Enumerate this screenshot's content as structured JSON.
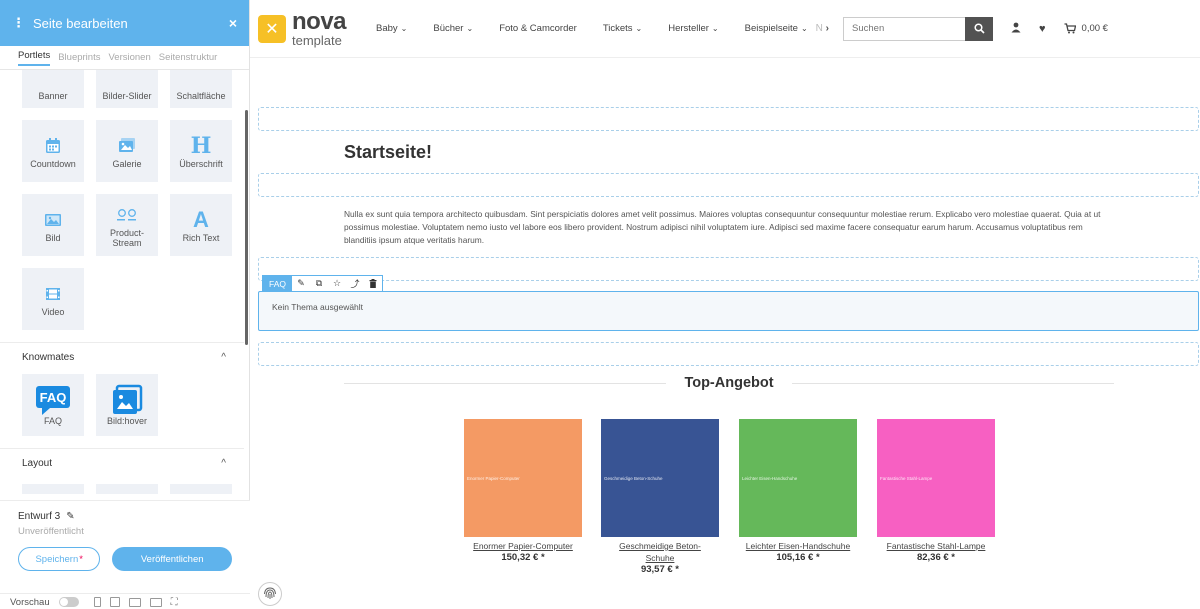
{
  "panel": {
    "title": "Seite bearbeiten",
    "tabs": [
      "Portlets",
      "Blueprints",
      "Versionen",
      "Seitenstruktur"
    ],
    "portlets_partial": [
      "Banner",
      "Bilder-Slider",
      "Schaltfläche"
    ],
    "portlets": [
      {
        "label": "Countdown",
        "icon": "calendar-icon"
      },
      {
        "label": "Galerie",
        "icon": "gallery-icon"
      },
      {
        "label": "Überschrift",
        "icon": "heading-icon",
        "glyph": "H"
      },
      {
        "label": "Bild",
        "icon": "image-icon"
      },
      {
        "label": "Product-\nStream",
        "icon": "product-stream-icon"
      },
      {
        "label": "Rich Text",
        "icon": "rich-text-icon",
        "glyph": "A"
      },
      {
        "label": "Video",
        "icon": "video-icon"
      }
    ],
    "sections": {
      "knowmates": "Knowmates",
      "layout": "Layout"
    },
    "knowmates": [
      {
        "label": "FAQ",
        "icon": "faq-icon",
        "glyph": "FAQ"
      },
      {
        "label": "Bild:hover",
        "icon": "image-hover-icon"
      }
    ],
    "footer": {
      "draft": "Entwurf 3",
      "status": "Unveröffentlicht",
      "save": "Speichern",
      "save_marker": "*",
      "publish": "Veröffentlichen",
      "preview": "Vorschau"
    }
  },
  "header": {
    "logo_big": "nova",
    "logo_small": "template",
    "nav": [
      "Baby",
      "Bücher",
      "Foto & Camcorder",
      "Tickets",
      "Hersteller",
      "Beispielseite"
    ],
    "nav_has_caret": [
      true,
      true,
      false,
      true,
      true,
      true
    ],
    "nav_more": "N",
    "search_placeholder": "Suchen",
    "cart_total": "0,00 €"
  },
  "content": {
    "title": "Startseite!",
    "text": "Nulla ex sunt quia tempora architecto quibusdam. Sint perspiciatis dolores amet velit possimus. Maiores voluptas consequuntur consequuntur molestiae rerum. Explicabo vero molestiae quaerat. Quia at ut possimus molestiae. Voluptatem nemo iusto vel labore eos libero provident. Nostrum adipisci nihil voluptatem iure. Adipisci sed maxime facere consequatur earum harum. Accusamus voluptatibus rem blanditiis ipsum atque veritatis harum.",
    "faq_label": "FAQ",
    "faq_empty": "Kein Thema ausgewählt",
    "top_heading": "Top-Angebot"
  },
  "products": [
    {
      "name": "Enormer Papier-Computer",
      "price": "150,32 € *",
      "img_text": "Enormer Papier-Computer",
      "color": "#f49a64"
    },
    {
      "name": "Geschmeidige Beton-Schuhe",
      "price": "93,57 € *",
      "img_text": "Geschmeidige Beton-Schuhe",
      "color": "#385494"
    },
    {
      "name": "Leichter Eisen-Handschuhe",
      "price": "105,16 € *",
      "img_text": "Leichter Eisen-Handschuhe",
      "color": "#65b85a"
    },
    {
      "name": "Fantastische Stahl-Lampe",
      "price": "82,36 € *",
      "img_text": "Fantastische Stahl-Lampe",
      "color": "#f760c2"
    }
  ],
  "colors": {
    "accent": "#5fb3ec",
    "logo": "#f6c026"
  }
}
